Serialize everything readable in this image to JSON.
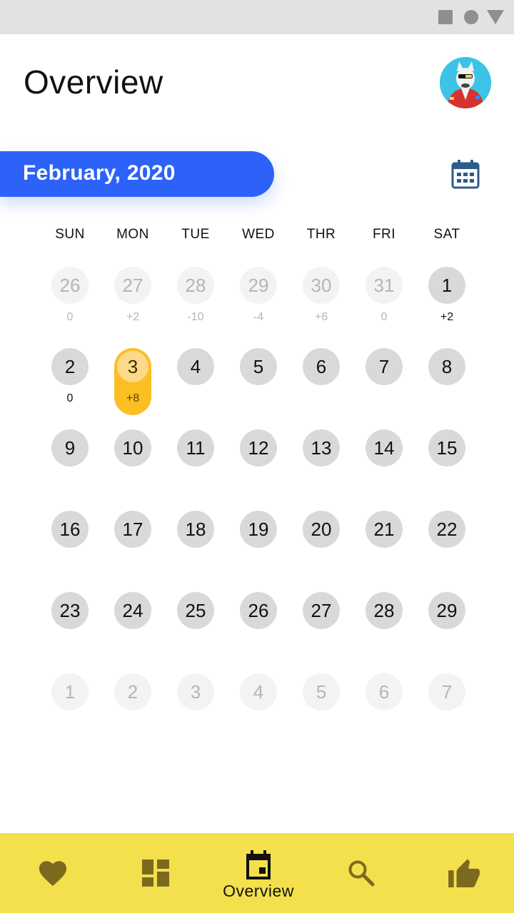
{
  "header": {
    "title": "Overview"
  },
  "month": {
    "label": "February, 2020"
  },
  "weekdays": [
    "SUN",
    "MON",
    "TUE",
    "WED",
    "THR",
    "FRI",
    "SAT"
  ],
  "weeks": [
    [
      {
        "day": "26",
        "delta": "0",
        "muted": true
      },
      {
        "day": "27",
        "delta": "+2",
        "muted": true
      },
      {
        "day": "28",
        "delta": "-10",
        "muted": true
      },
      {
        "day": "29",
        "delta": "-4",
        "muted": true
      },
      {
        "day": "30",
        "delta": "+6",
        "muted": true
      },
      {
        "day": "31",
        "delta": "0",
        "muted": true
      },
      {
        "day": "1",
        "delta": "+2",
        "muted": false
      }
    ],
    [
      {
        "day": "2",
        "delta": "0",
        "muted": false
      },
      {
        "day": "3",
        "delta": "+8",
        "muted": false,
        "selected": true
      },
      {
        "day": "4",
        "delta": "",
        "muted": false
      },
      {
        "day": "5",
        "delta": "",
        "muted": false
      },
      {
        "day": "6",
        "delta": "",
        "muted": false
      },
      {
        "day": "7",
        "delta": "",
        "muted": false
      },
      {
        "day": "8",
        "delta": "",
        "muted": false
      }
    ],
    [
      {
        "day": "9",
        "delta": "",
        "muted": false
      },
      {
        "day": "10",
        "delta": "",
        "muted": false
      },
      {
        "day": "11",
        "delta": "",
        "muted": false
      },
      {
        "day": "12",
        "delta": "",
        "muted": false
      },
      {
        "day": "13",
        "delta": "",
        "muted": false
      },
      {
        "day": "14",
        "delta": "",
        "muted": false
      },
      {
        "day": "15",
        "delta": "",
        "muted": false
      }
    ],
    [
      {
        "day": "16",
        "delta": "",
        "muted": false
      },
      {
        "day": "17",
        "delta": "",
        "muted": false
      },
      {
        "day": "18",
        "delta": "",
        "muted": false
      },
      {
        "day": "19",
        "delta": "",
        "muted": false
      },
      {
        "day": "20",
        "delta": "",
        "muted": false
      },
      {
        "day": "21",
        "delta": "",
        "muted": false
      },
      {
        "day": "22",
        "delta": "",
        "muted": false
      }
    ],
    [
      {
        "day": "23",
        "delta": "",
        "muted": false
      },
      {
        "day": "24",
        "delta": "",
        "muted": false
      },
      {
        "day": "25",
        "delta": "",
        "muted": false
      },
      {
        "day": "26",
        "delta": "",
        "muted": false
      },
      {
        "day": "27",
        "delta": "",
        "muted": false
      },
      {
        "day": "28",
        "delta": "",
        "muted": false
      },
      {
        "day": "29",
        "delta": "",
        "muted": false
      }
    ],
    [
      {
        "day": "1",
        "delta": "",
        "muted": true
      },
      {
        "day": "2",
        "delta": "",
        "muted": true
      },
      {
        "day": "3",
        "delta": "",
        "muted": true
      },
      {
        "day": "4",
        "delta": "",
        "muted": true
      },
      {
        "day": "5",
        "delta": "",
        "muted": true
      },
      {
        "day": "6",
        "delta": "",
        "muted": true
      },
      {
        "day": "7",
        "delta": "",
        "muted": true
      }
    ]
  ],
  "bottom_nav": {
    "items": [
      {
        "icon": "heart-icon"
      },
      {
        "icon": "dashboard-icon"
      },
      {
        "icon": "event-icon",
        "label": "Overview",
        "active": true
      },
      {
        "icon": "search-icon"
      },
      {
        "icon": "thumb-up-icon"
      }
    ]
  },
  "colors": {
    "accent_blue": "#2d62f8",
    "selected_yellow": "#fbbf24",
    "nav_bar": "#f4e04d",
    "nav_icon": "#7b6a1e",
    "day_circle": "#d9d9d9",
    "day_circle_muted": "#f3f3f3"
  }
}
